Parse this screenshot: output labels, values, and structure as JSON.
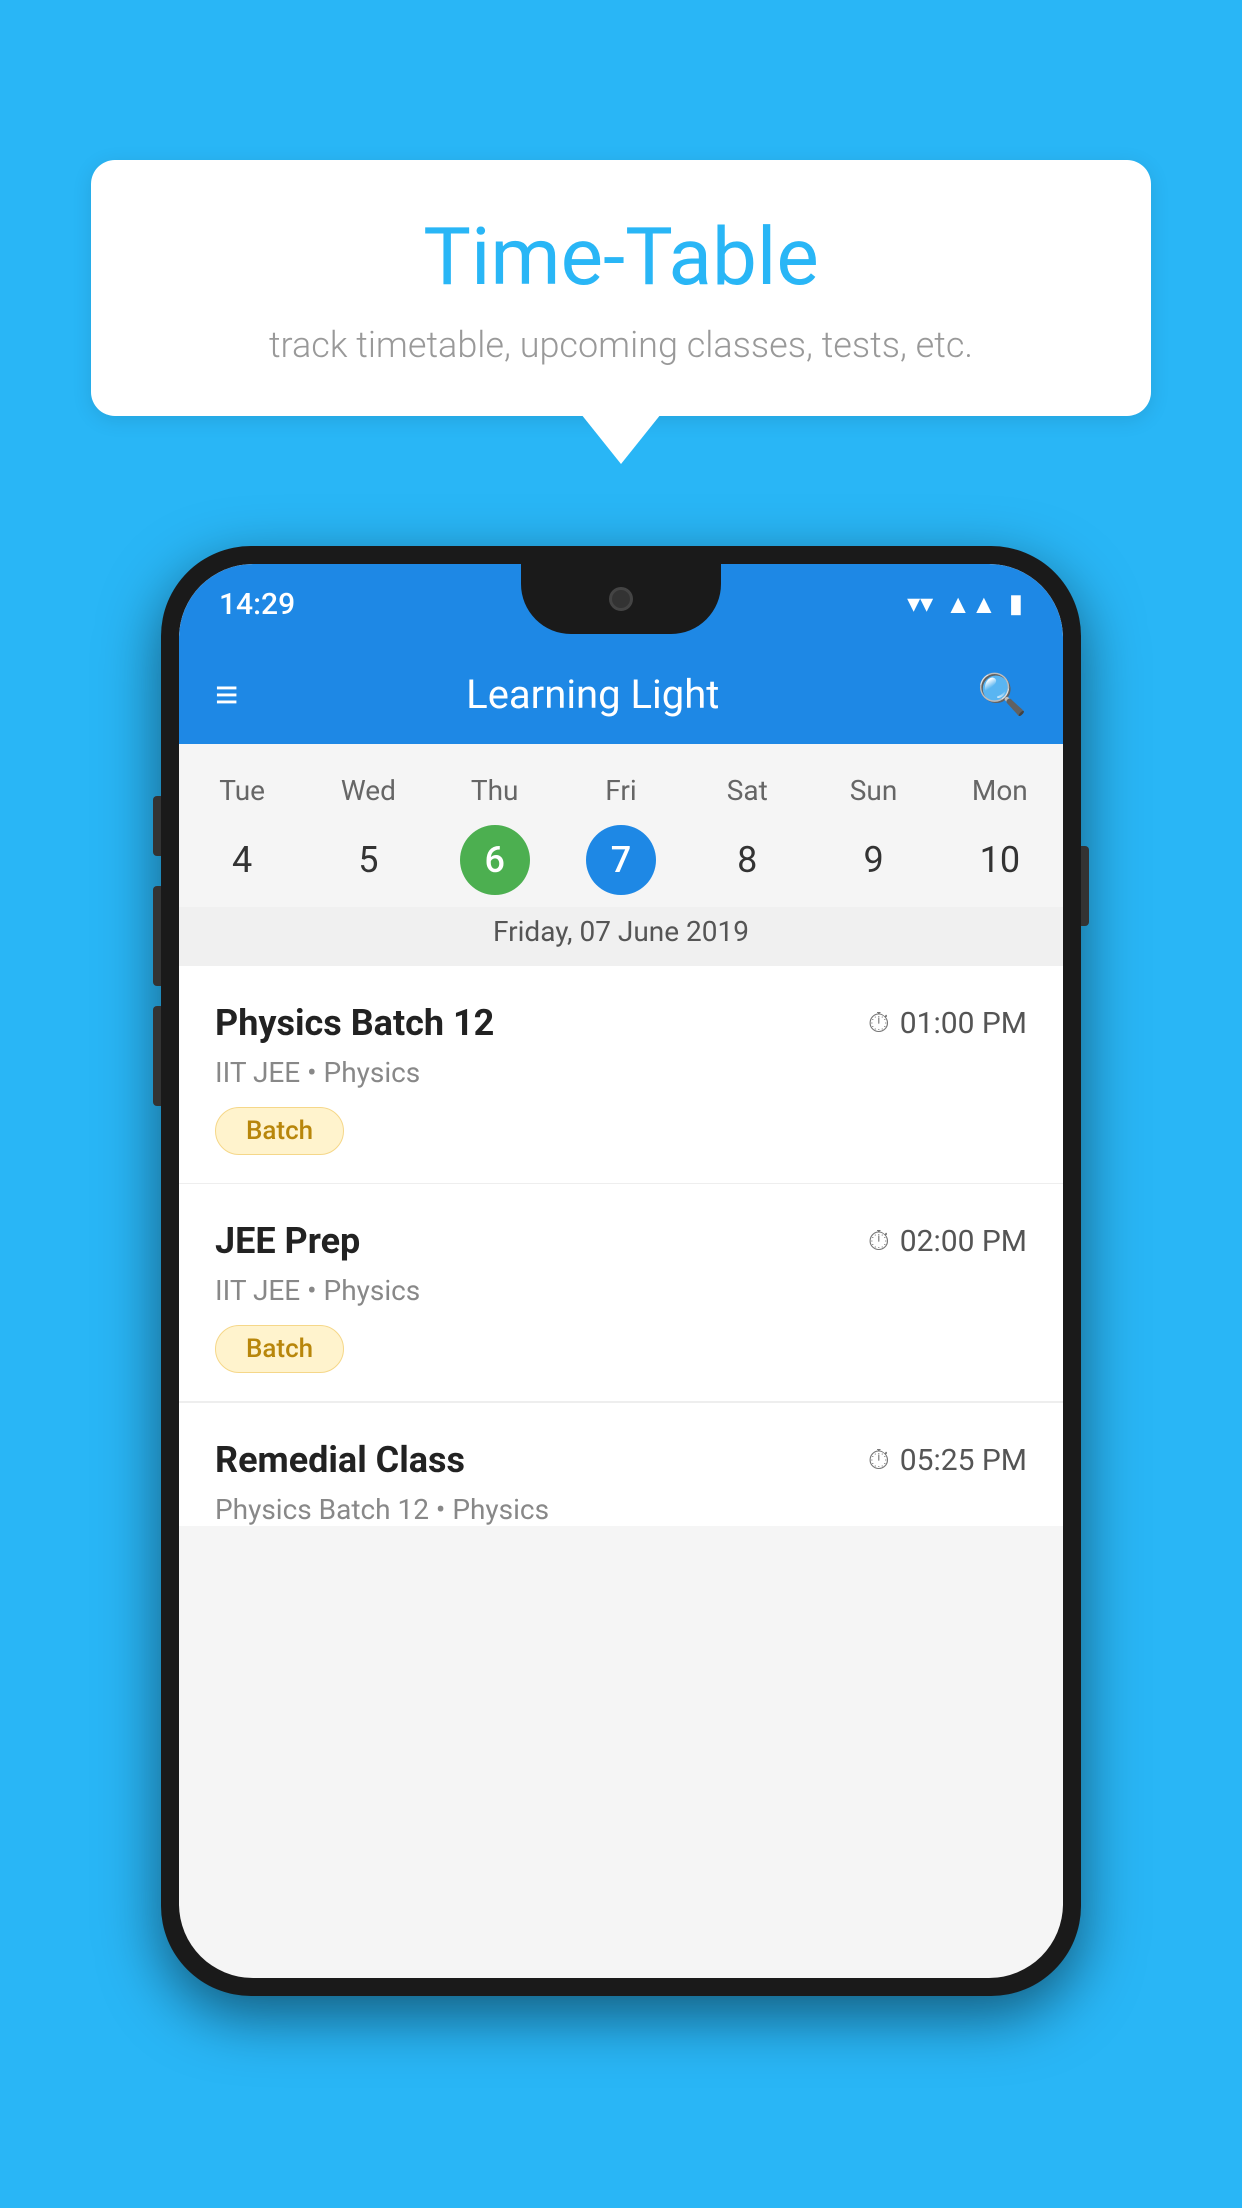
{
  "background_color": "#29B6F6",
  "speech_bubble": {
    "title": "Time-Table",
    "subtitle": "track timetable, upcoming classes, tests, etc."
  },
  "phone": {
    "status_bar": {
      "time": "14:29",
      "icons": [
        "wifi",
        "signal",
        "battery"
      ]
    },
    "toolbar": {
      "title": "Learning Light",
      "menu_icon": "≡",
      "search_icon": "🔍"
    },
    "calendar": {
      "days": [
        "Tue",
        "Wed",
        "Thu",
        "Fri",
        "Sat",
        "Sun",
        "Mon"
      ],
      "dates": [
        "4",
        "5",
        "6",
        "7",
        "8",
        "9",
        "10"
      ],
      "today_index": 2,
      "selected_index": 3,
      "selected_label": "Friday, 07 June 2019"
    },
    "schedule": [
      {
        "title": "Physics Batch 12",
        "time": "01:00 PM",
        "meta": "IIT JEE • Physics",
        "tag": "Batch"
      },
      {
        "title": "JEE Prep",
        "time": "02:00 PM",
        "meta": "IIT JEE • Physics",
        "tag": "Batch"
      },
      {
        "title": "Remedial Class",
        "time": "05:25 PM",
        "meta": "Physics Batch 12 • Physics",
        "tag": ""
      }
    ]
  }
}
